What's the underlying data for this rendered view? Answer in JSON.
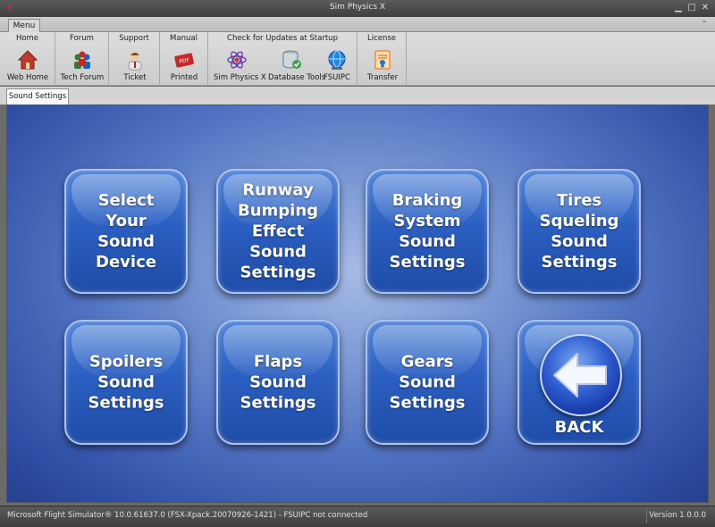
{
  "window": {
    "title": "Sim Physics X",
    "controls": [
      "minimize-icon",
      "maximize-icon",
      "close-icon"
    ]
  },
  "ribbon": {
    "tab": "Menu",
    "groups": [
      {
        "title": "Home",
        "buttons": [
          {
            "label": "Web Home",
            "icon": "house-icon"
          }
        ]
      },
      {
        "title": "Forum",
        "buttons": [
          {
            "label": "Tech Forum",
            "icon": "people-icon"
          }
        ]
      },
      {
        "title": "Support",
        "buttons": [
          {
            "label": "Ticket",
            "icon": "support-agent-icon"
          }
        ]
      },
      {
        "title": "Manual",
        "buttons": [
          {
            "label": "Printed",
            "icon": "pdf-icon"
          }
        ]
      },
      {
        "title": "Check for Updates at Startup",
        "buttons": [
          {
            "label": "Sim Physics X",
            "icon": "atom-icon"
          },
          {
            "label": "Database Tools",
            "icon": "database-icon"
          },
          {
            "label": "FSUIPC",
            "icon": "globe-icon"
          }
        ]
      },
      {
        "title": "License",
        "buttons": [
          {
            "label": "Transfer",
            "icon": "license-icon"
          }
        ]
      }
    ]
  },
  "doc_tab": "Sound Settings",
  "buttons": [
    {
      "label": "Select\nYour\nSound\nDevice"
    },
    {
      "label": "Runway\nBumping\nEffect\nSound\nSettings"
    },
    {
      "label": "Braking\nSystem\nSound\nSettings"
    },
    {
      "label": "Tires\nSqueling\nSound\nSettings"
    },
    {
      "label": "Spoilers\nSound\nSettings"
    },
    {
      "label": "Flaps\nSound\nSettings"
    },
    {
      "label": "Gears\nSound\nSettings"
    },
    {
      "label": "BACK",
      "icon": "back-arrow-icon"
    }
  ],
  "status": {
    "left": "Microsoft Flight Simulator® 10.0.61637.0 (FSX-Xpack.20070926-1421)   -  FSUIPC not connected",
    "right": "Version 1.0.0.0"
  },
  "colors": {
    "canvas_center": "#a6bbe6",
    "canvas_edge": "#263f90",
    "button_blue": "#2b5fc1",
    "chrome_dark": "#4a4a4a"
  }
}
